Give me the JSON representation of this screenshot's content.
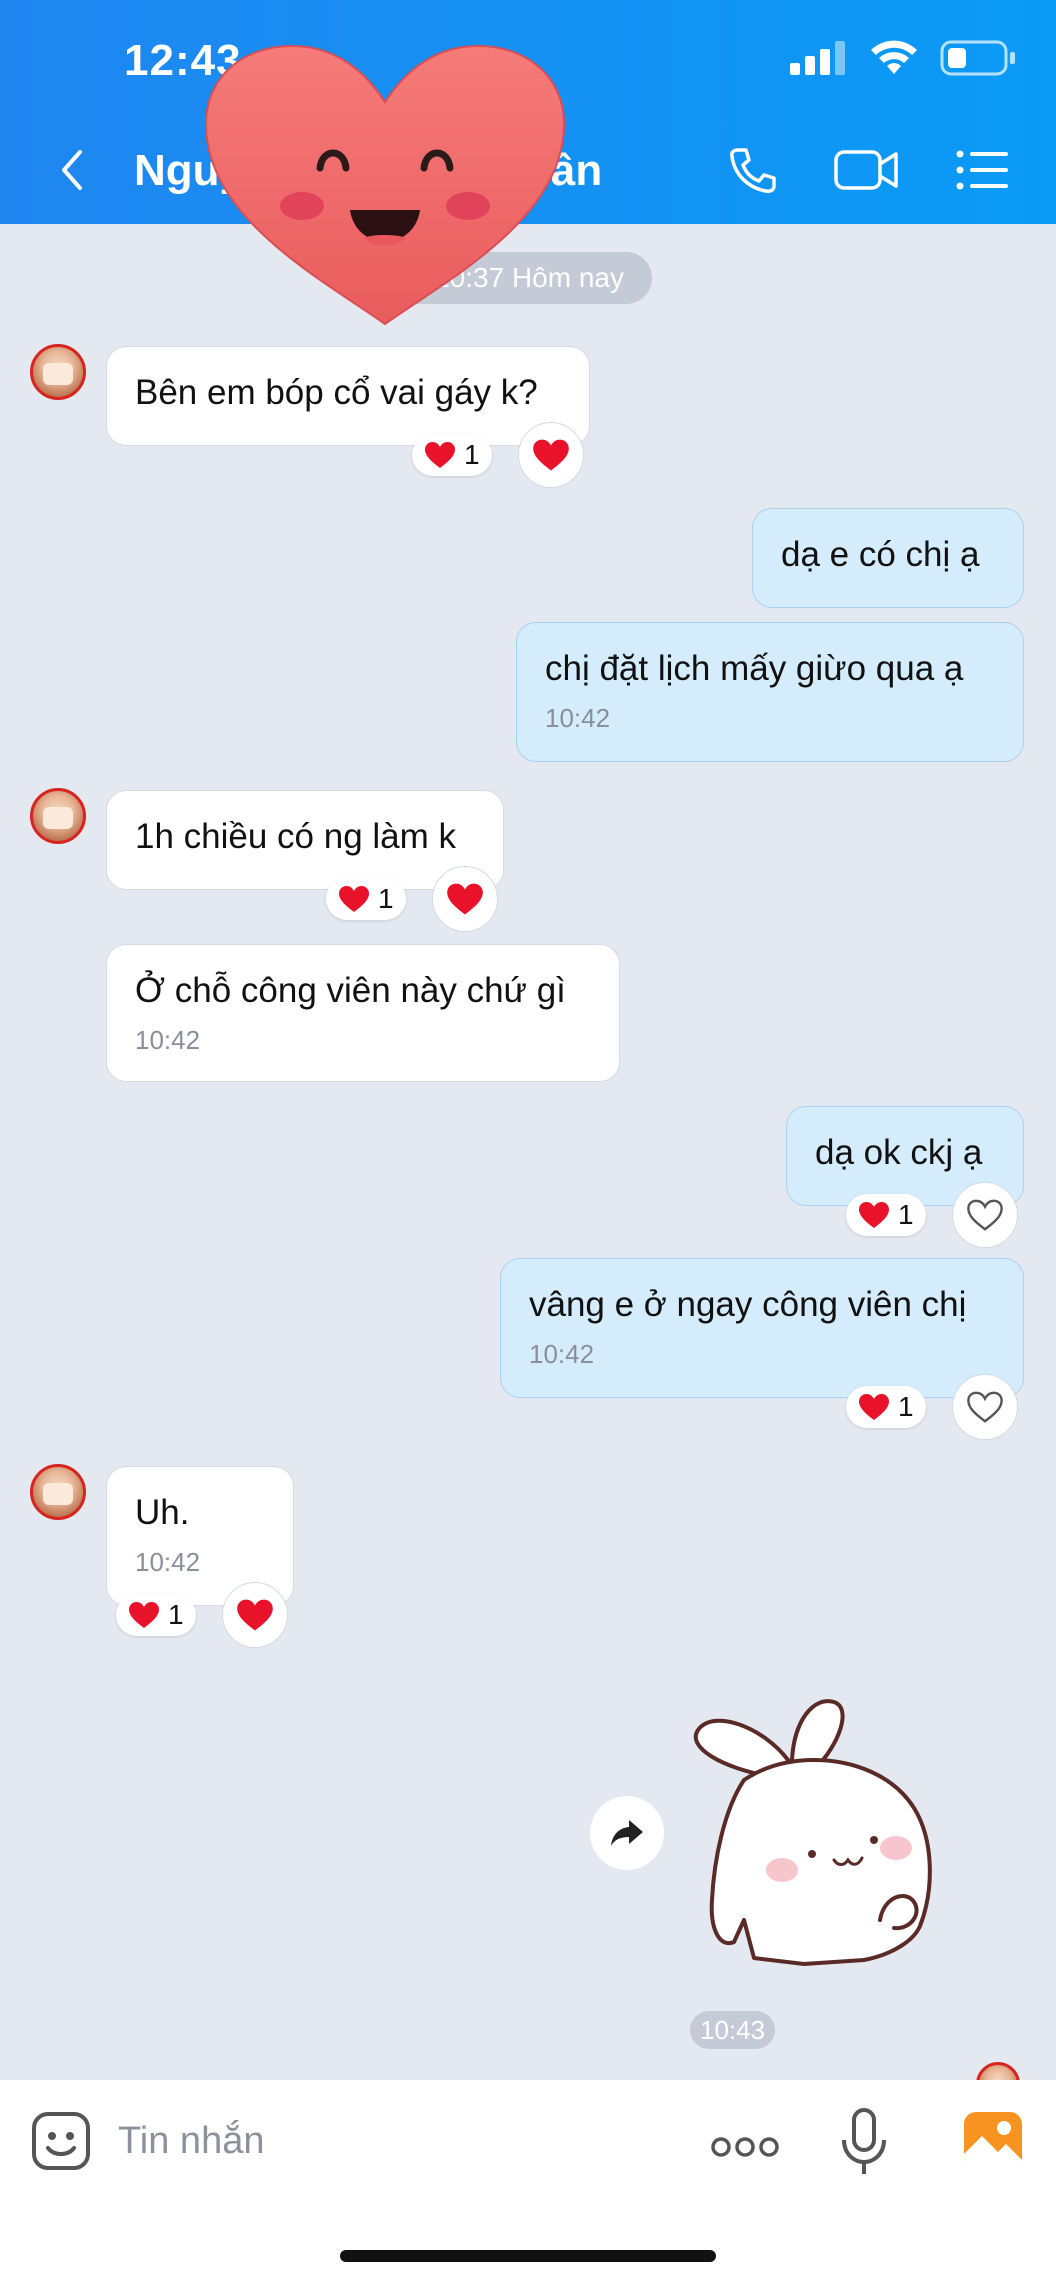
{
  "status": {
    "time": "12:43"
  },
  "header": {
    "title_left": "Nguy",
    "title_right": "Tân"
  },
  "date_pill": "10:37 Hôm nay",
  "messages": [
    {
      "text": "Bên em bóp cổ vai gáy k?",
      "reaction_count": "1"
    },
    {
      "text": "dạ e có chị ạ"
    },
    {
      "text": "chị đặt lịch mấy giừo qua ạ",
      "time": "10:42"
    },
    {
      "text": "1h chiều có ng làm k",
      "reaction_count": "1"
    },
    {
      "text": "Ở chỗ công viên này chứ gì",
      "time": "10:42"
    },
    {
      "text": "dạ ok ckj ạ",
      "reaction_count": "1"
    },
    {
      "text": "vâng e ở ngay công viên chị",
      "time": "10:42",
      "reaction_count": "1"
    },
    {
      "text": "Uh.",
      "time": "10:42",
      "reaction_count": "1"
    }
  ],
  "sticker_time": "10:43",
  "composer": {
    "placeholder": "Tin nhắn"
  },
  "colors": {
    "header": "#1F86F0",
    "out_bubble": "#D4ECFC",
    "in_bubble": "#FFFFFF",
    "reaction_heart": "#E8132B",
    "accent_orange": "#F7931E"
  },
  "icons": [
    "back-icon",
    "phone-icon",
    "video-icon",
    "menu-icon",
    "heart-icon",
    "forward-icon",
    "emoji-icon",
    "more-icon",
    "microphone-icon",
    "image-icon"
  ]
}
